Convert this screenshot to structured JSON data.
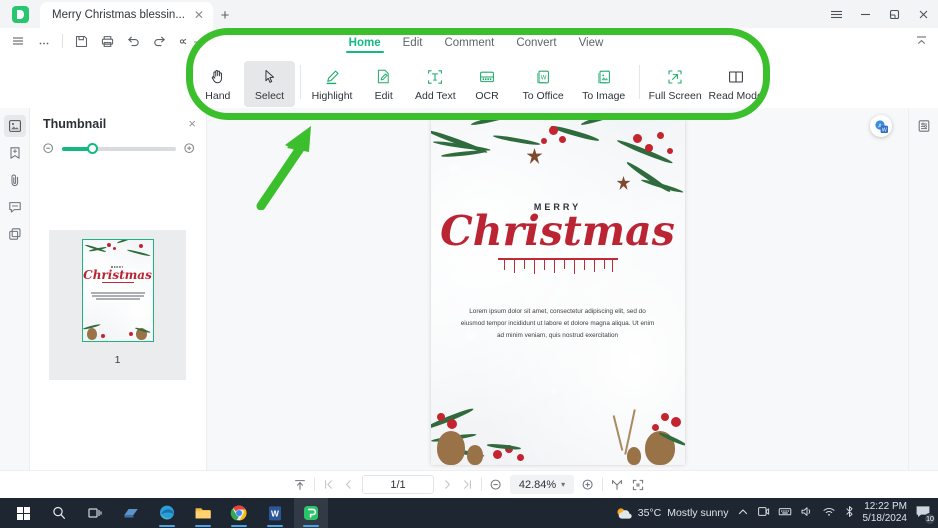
{
  "window": {
    "tab_title": "Merry Christmas blessin...",
    "new_tab_label": "+",
    "controls": {
      "menu": "menu-icon",
      "minimize": "minimize",
      "maximize": "restore",
      "close": "close"
    }
  },
  "command_bar": {
    "items": [
      {
        "name": "hamburger-menu-icon",
        "label": "Menu"
      },
      {
        "name": "more-options-icon",
        "label": "More"
      },
      {
        "name": "save-icon",
        "label": "Save"
      },
      {
        "name": "print-icon",
        "label": "Print"
      },
      {
        "name": "undo-icon",
        "label": "Undo"
      },
      {
        "name": "redo-icon",
        "label": "Redo"
      },
      {
        "name": "share-icon",
        "label": "Share"
      }
    ]
  },
  "ribbon": {
    "tabs": [
      {
        "label": "Home",
        "active": true
      },
      {
        "label": "Edit",
        "active": false
      },
      {
        "label": "Comment",
        "active": false
      },
      {
        "label": "Convert",
        "active": false
      },
      {
        "label": "View",
        "active": false
      }
    ],
    "tools": [
      {
        "label": "Hand",
        "icon": "hand-icon",
        "active": false
      },
      {
        "label": "Select",
        "icon": "cursor-arrow-icon",
        "active": true
      },
      {
        "label": "Highlight",
        "icon": "highlighter-icon",
        "active": false
      },
      {
        "label": "Edit",
        "icon": "edit-document-icon",
        "active": false
      },
      {
        "label": "Add Text",
        "icon": "add-text-icon",
        "active": false
      },
      {
        "label": "OCR",
        "icon": "ocr-icon",
        "active": false
      },
      {
        "label": "To Office",
        "icon": "to-office-icon",
        "active": false
      },
      {
        "label": "To Image",
        "icon": "to-image-icon",
        "active": false
      },
      {
        "label": "Full Screen",
        "icon": "full-screen-icon",
        "active": false
      },
      {
        "label": "Read Mode",
        "icon": "read-mode-icon",
        "active": false
      }
    ]
  },
  "left_rail": {
    "items": [
      {
        "name": "thumbnail-panel-icon",
        "label": "Thumbnail",
        "active": true
      },
      {
        "name": "bookmark-icon",
        "label": "Bookmark",
        "active": false
      },
      {
        "name": "attachment-icon",
        "label": "Attachment",
        "active": false
      },
      {
        "name": "comment-icon",
        "label": "Comment",
        "active": false
      },
      {
        "name": "pages-icon",
        "label": "Pages",
        "active": false
      }
    ]
  },
  "thumbnail_panel": {
    "title": "Thumbnail",
    "close_label": "×",
    "zoom_out_label": "Zoom out",
    "zoom_in_label": "Zoom in",
    "slider_value": 26,
    "page_number": "1"
  },
  "document": {
    "heading_small": "MERRY",
    "heading_script": "Christmas",
    "body": "Lorem ipsum dolor sit amet, consectetur adipiscing elit, sed do eiusmod tempor incididunt ut labore et dolore magna aliqua. Ut enim ad minim veniam, quis nostrud exercitation"
  },
  "status_bar": {
    "fit_page_label": "Fit page",
    "first_page_label": "First page",
    "prev_page_label": "Previous page",
    "page_indicator": "1/1",
    "next_page_label": "Next page",
    "last_page_label": "Last page",
    "zoom_out_label": "Zoom out",
    "zoom_value": "42.84%",
    "zoom_caret": "▾",
    "zoom_in_label": "Zoom in",
    "fit_width_label": "Fit width",
    "fit_visible_label": "Fit visible"
  },
  "right_rail": {
    "properties_label": "Properties",
    "translate_label": "Translate"
  },
  "annotation": {
    "shape": "rounded-rectangle-highlight",
    "arrow": "pointer-arrow",
    "color": "#3cbf2c"
  },
  "taskbar": {
    "items": [
      {
        "name": "start-button",
        "label": "Start"
      },
      {
        "name": "search-button",
        "label": "Search"
      },
      {
        "name": "task-view-button",
        "label": "Task View"
      },
      {
        "name": "widgets-button",
        "label": "Widgets"
      },
      {
        "name": "edge-button",
        "label": "Microsoft Edge"
      },
      {
        "name": "file-explorer-button",
        "label": "File Explorer"
      },
      {
        "name": "chrome-button",
        "label": "Google Chrome"
      },
      {
        "name": "word-button",
        "label": "Microsoft Word"
      },
      {
        "name": "pdf-reader-button",
        "label": "PDF Reader"
      }
    ],
    "weather": {
      "temperature": "35°C",
      "condition": "Mostly sunny"
    },
    "tray": {
      "show_hidden": "^",
      "meeting": "meeting-icon",
      "keyboard": "keyboard-icon",
      "volume": "volume-icon",
      "network": "wifi-icon",
      "bluetooth": "bluetooth-icon"
    },
    "clock": {
      "time": "12:22 PM",
      "date": "5/18/2024"
    },
    "notification_count": "10"
  }
}
